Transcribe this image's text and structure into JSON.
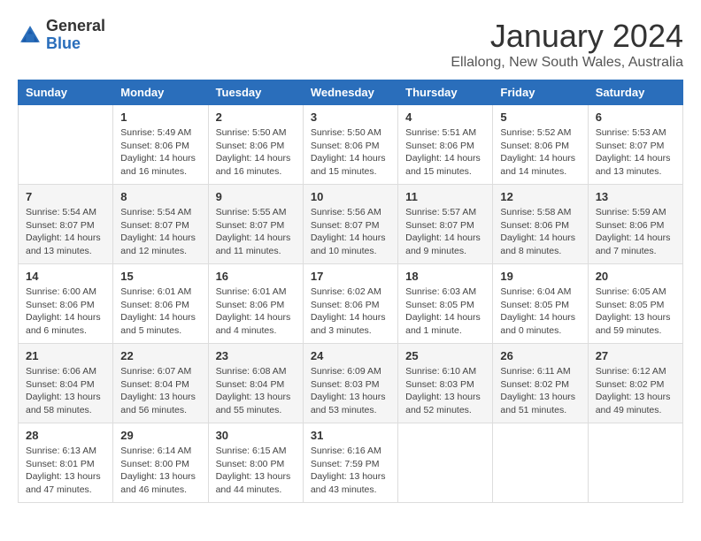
{
  "header": {
    "logo_general": "General",
    "logo_blue": "Blue",
    "month_title": "January 2024",
    "location": "Ellalong, New South Wales, Australia"
  },
  "days_of_week": [
    "Sunday",
    "Monday",
    "Tuesday",
    "Wednesday",
    "Thursday",
    "Friday",
    "Saturday"
  ],
  "weeks": [
    [
      {
        "day": "",
        "info": ""
      },
      {
        "day": "1",
        "info": "Sunrise: 5:49 AM\nSunset: 8:06 PM\nDaylight: 14 hours\nand 16 minutes."
      },
      {
        "day": "2",
        "info": "Sunrise: 5:50 AM\nSunset: 8:06 PM\nDaylight: 14 hours\nand 16 minutes."
      },
      {
        "day": "3",
        "info": "Sunrise: 5:50 AM\nSunset: 8:06 PM\nDaylight: 14 hours\nand 15 minutes."
      },
      {
        "day": "4",
        "info": "Sunrise: 5:51 AM\nSunset: 8:06 PM\nDaylight: 14 hours\nand 15 minutes."
      },
      {
        "day": "5",
        "info": "Sunrise: 5:52 AM\nSunset: 8:06 PM\nDaylight: 14 hours\nand 14 minutes."
      },
      {
        "day": "6",
        "info": "Sunrise: 5:53 AM\nSunset: 8:07 PM\nDaylight: 14 hours\nand 13 minutes."
      }
    ],
    [
      {
        "day": "7",
        "info": "Sunrise: 5:54 AM\nSunset: 8:07 PM\nDaylight: 14 hours\nand 13 minutes."
      },
      {
        "day": "8",
        "info": "Sunrise: 5:54 AM\nSunset: 8:07 PM\nDaylight: 14 hours\nand 12 minutes."
      },
      {
        "day": "9",
        "info": "Sunrise: 5:55 AM\nSunset: 8:07 PM\nDaylight: 14 hours\nand 11 minutes."
      },
      {
        "day": "10",
        "info": "Sunrise: 5:56 AM\nSunset: 8:07 PM\nDaylight: 14 hours\nand 10 minutes."
      },
      {
        "day": "11",
        "info": "Sunrise: 5:57 AM\nSunset: 8:07 PM\nDaylight: 14 hours\nand 9 minutes."
      },
      {
        "day": "12",
        "info": "Sunrise: 5:58 AM\nSunset: 8:06 PM\nDaylight: 14 hours\nand 8 minutes."
      },
      {
        "day": "13",
        "info": "Sunrise: 5:59 AM\nSunset: 8:06 PM\nDaylight: 14 hours\nand 7 minutes."
      }
    ],
    [
      {
        "day": "14",
        "info": "Sunrise: 6:00 AM\nSunset: 8:06 PM\nDaylight: 14 hours\nand 6 minutes."
      },
      {
        "day": "15",
        "info": "Sunrise: 6:01 AM\nSunset: 8:06 PM\nDaylight: 14 hours\nand 5 minutes."
      },
      {
        "day": "16",
        "info": "Sunrise: 6:01 AM\nSunset: 8:06 PM\nDaylight: 14 hours\nand 4 minutes."
      },
      {
        "day": "17",
        "info": "Sunrise: 6:02 AM\nSunset: 8:06 PM\nDaylight: 14 hours\nand 3 minutes."
      },
      {
        "day": "18",
        "info": "Sunrise: 6:03 AM\nSunset: 8:05 PM\nDaylight: 14 hours\nand 1 minute."
      },
      {
        "day": "19",
        "info": "Sunrise: 6:04 AM\nSunset: 8:05 PM\nDaylight: 14 hours\nand 0 minutes."
      },
      {
        "day": "20",
        "info": "Sunrise: 6:05 AM\nSunset: 8:05 PM\nDaylight: 13 hours\nand 59 minutes."
      }
    ],
    [
      {
        "day": "21",
        "info": "Sunrise: 6:06 AM\nSunset: 8:04 PM\nDaylight: 13 hours\nand 58 minutes."
      },
      {
        "day": "22",
        "info": "Sunrise: 6:07 AM\nSunset: 8:04 PM\nDaylight: 13 hours\nand 56 minutes."
      },
      {
        "day": "23",
        "info": "Sunrise: 6:08 AM\nSunset: 8:04 PM\nDaylight: 13 hours\nand 55 minutes."
      },
      {
        "day": "24",
        "info": "Sunrise: 6:09 AM\nSunset: 8:03 PM\nDaylight: 13 hours\nand 53 minutes."
      },
      {
        "day": "25",
        "info": "Sunrise: 6:10 AM\nSunset: 8:03 PM\nDaylight: 13 hours\nand 52 minutes."
      },
      {
        "day": "26",
        "info": "Sunrise: 6:11 AM\nSunset: 8:02 PM\nDaylight: 13 hours\nand 51 minutes."
      },
      {
        "day": "27",
        "info": "Sunrise: 6:12 AM\nSunset: 8:02 PM\nDaylight: 13 hours\nand 49 minutes."
      }
    ],
    [
      {
        "day": "28",
        "info": "Sunrise: 6:13 AM\nSunset: 8:01 PM\nDaylight: 13 hours\nand 47 minutes."
      },
      {
        "day": "29",
        "info": "Sunrise: 6:14 AM\nSunset: 8:00 PM\nDaylight: 13 hours\nand 46 minutes."
      },
      {
        "day": "30",
        "info": "Sunrise: 6:15 AM\nSunset: 8:00 PM\nDaylight: 13 hours\nand 44 minutes."
      },
      {
        "day": "31",
        "info": "Sunrise: 6:16 AM\nSunset: 7:59 PM\nDaylight: 13 hours\nand 43 minutes."
      },
      {
        "day": "",
        "info": ""
      },
      {
        "day": "",
        "info": ""
      },
      {
        "day": "",
        "info": ""
      }
    ]
  ]
}
